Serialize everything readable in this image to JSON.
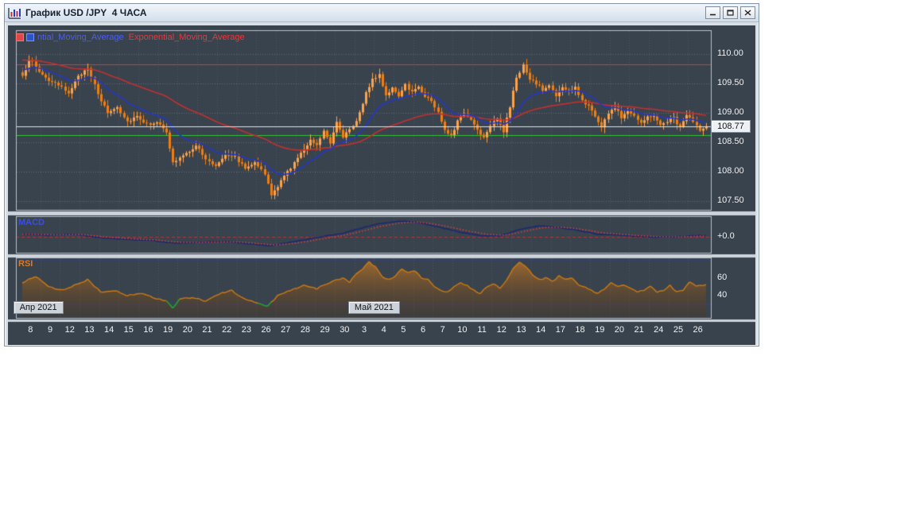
{
  "window": {
    "title": "График USD /JPY  4 ЧАСА"
  },
  "legend": {
    "ma1_label": "ntial_Moving_Average",
    "ma2_label": "Exponential_Moving_Average",
    "ma1_color": "#4b5ef0",
    "ma2_color": "#e23b3b"
  },
  "panels": {
    "macd_label": "MACD",
    "macd_color": "#3d4fd8",
    "rsi_label": "RSI",
    "rsi_color": "#e0781c"
  },
  "badges": [
    {
      "label": "Апр 2021",
      "day_index": 0.4
    },
    {
      "label": "Май 2021",
      "day_index": 17.5
    }
  ],
  "price_tag": "108.77",
  "chart_data": {
    "type": "candlestick",
    "title": "USD/JPY 4-hour candles with two exponential moving averages, MACD and RSI",
    "x_day_labels": [
      "8",
      "9",
      "12",
      "13",
      "14",
      "15",
      "16",
      "19",
      "20",
      "21",
      "22",
      "23",
      "26",
      "27",
      "28",
      "29",
      "30",
      "3",
      "4",
      "5",
      "6",
      "7",
      "10",
      "11",
      "12",
      "13",
      "14",
      "17",
      "18",
      "19",
      "20",
      "21",
      "24",
      "25",
      "26"
    ],
    "candles_per_day": 6,
    "colors": {
      "background": "#39434d",
      "panel_border": "#b9c1c9",
      "splitter": "#ccd3da",
      "grid": "rgba(255,255,255,0.22)",
      "grid_vert": "rgba(255,255,255,0.10)",
      "candle_up": "#ffa24a",
      "candle_down": "#f07d10",
      "ema_fast": "#2438c8",
      "ema_slow": "#c43030",
      "level_red": "#d83838",
      "level_green": "#28c828",
      "current_line": "#e2e2e2",
      "macd_line": "#1c2870",
      "macd_signal": "#e04040",
      "macd_zero": "#b43434",
      "rsi_line": "#cf7a12",
      "rsi_green": "#22b022",
      "rsi_level": "#2838d0",
      "axis_text": "#f0f0f0"
    },
    "main": {
      "y_range": [
        107.35,
        110.4
      ],
      "y_ticks": [
        110.0,
        109.5,
        109.0,
        108.5,
        108.0,
        107.5
      ],
      "levels": {
        "resistance_red": 109.82,
        "support_green": 108.62,
        "current_price": 108.77
      },
      "ema_fast_period": 16,
      "ema_slow_period": 56,
      "price_anchors": [
        [
          0,
          109.6
        ],
        [
          2,
          109.92
        ],
        [
          5,
          109.7
        ],
        [
          8,
          109.55
        ],
        [
          11,
          109.45
        ],
        [
          14,
          109.35
        ],
        [
          17,
          109.6
        ],
        [
          20,
          109.78
        ],
        [
          23,
          109.3
        ],
        [
          26,
          109.0
        ],
        [
          29,
          109.1
        ],
        [
          32,
          108.85
        ],
        [
          35,
          108.95
        ],
        [
          38,
          108.8
        ],
        [
          41,
          108.85
        ],
        [
          44,
          108.65
        ],
        [
          46,
          108.15
        ],
        [
          50,
          108.3
        ],
        [
          53,
          108.45
        ],
        [
          56,
          108.2
        ],
        [
          59,
          108.1
        ],
        [
          62,
          108.3
        ],
        [
          65,
          108.25
        ],
        [
          68,
          108.05
        ],
        [
          71,
          108.18
        ],
        [
          74,
          107.95
        ],
        [
          76,
          107.6
        ],
        [
          78,
          107.75
        ],
        [
          81,
          108.0
        ],
        [
          83,
          108.15
        ],
        [
          85,
          108.3
        ],
        [
          88,
          108.55
        ],
        [
          90,
          108.45
        ],
        [
          92,
          108.7
        ],
        [
          94,
          108.5
        ],
        [
          96,
          108.85
        ],
        [
          98,
          108.6
        ],
        [
          101,
          108.75
        ],
        [
          103,
          109.0
        ],
        [
          105,
          109.35
        ],
        [
          107,
          109.55
        ],
        [
          109,
          109.65
        ],
        [
          111,
          109.3
        ],
        [
          113,
          109.42
        ],
        [
          115,
          109.25
        ],
        [
          117,
          109.48
        ],
        [
          119,
          109.35
        ],
        [
          121,
          109.45
        ],
        [
          123,
          109.28
        ],
        [
          125,
          109.2
        ],
        [
          127,
          109.0
        ],
        [
          129,
          108.72
        ],
        [
          131,
          108.62
        ],
        [
          133,
          108.85
        ],
        [
          135,
          109.0
        ],
        [
          137,
          108.88
        ],
        [
          139,
          108.72
        ],
        [
          141,
          108.58
        ],
        [
          143,
          108.8
        ],
        [
          145,
          108.92
        ],
        [
          147,
          108.68
        ],
        [
          149,
          109.1
        ],
        [
          151,
          109.6
        ],
        [
          153,
          109.8
        ],
        [
          155,
          109.55
        ],
        [
          157,
          109.5
        ],
        [
          159,
          109.38
        ],
        [
          161,
          109.46
        ],
        [
          163,
          109.3
        ],
        [
          165,
          109.42
        ],
        [
          167,
          109.36
        ],
        [
          169,
          109.42
        ],
        [
          171,
          109.2
        ],
        [
          173,
          109.12
        ],
        [
          175,
          108.95
        ],
        [
          177,
          108.75
        ],
        [
          179,
          109.0
        ],
        [
          181,
          109.1
        ],
        [
          183,
          108.92
        ],
        [
          185,
          109.05
        ],
        [
          187,
          108.95
        ],
        [
          189,
          108.85
        ],
        [
          191,
          108.92
        ],
        [
          193,
          108.96
        ],
        [
          195,
          108.78
        ],
        [
          197,
          108.86
        ],
        [
          199,
          108.92
        ],
        [
          201,
          108.74
        ],
        [
          203,
          108.95
        ],
        [
          205,
          108.85
        ],
        [
          207,
          108.68
        ],
        [
          209,
          108.77
        ]
      ]
    },
    "macd": {
      "range": [
        -0.35,
        0.45
      ],
      "zero_label": "+0.0",
      "signal_period": 9,
      "anchors": [
        [
          0,
          0.06
        ],
        [
          8,
          0.03
        ],
        [
          16,
          0.05
        ],
        [
          24,
          -0.02
        ],
        [
          32,
          -0.06
        ],
        [
          40,
          -0.08
        ],
        [
          46,
          -0.14
        ],
        [
          54,
          -0.12
        ],
        [
          62,
          -0.1
        ],
        [
          70,
          -0.16
        ],
        [
          76,
          -0.2
        ],
        [
          82,
          -0.12
        ],
        [
          90,
          -0.02
        ],
        [
          98,
          0.08
        ],
        [
          104,
          0.2
        ],
        [
          110,
          0.3
        ],
        [
          116,
          0.34
        ],
        [
          122,
          0.3
        ],
        [
          128,
          0.2
        ],
        [
          134,
          0.1
        ],
        [
          140,
          0.02
        ],
        [
          146,
          0.02
        ],
        [
          152,
          0.16
        ],
        [
          158,
          0.24
        ],
        [
          164,
          0.2
        ],
        [
          170,
          0.14
        ],
        [
          176,
          0.05
        ],
        [
          182,
          0.04
        ],
        [
          188,
          0.01
        ],
        [
          194,
          -0.01
        ],
        [
          200,
          0.0
        ],
        [
          205,
          0.02
        ],
        [
          209,
          0.03
        ]
      ]
    },
    "rsi": {
      "range": [
        15,
        83
      ],
      "level_lines": [
        80,
        30
      ],
      "tick_values": [
        60,
        40
      ],
      "green_below": 31,
      "anchors": [
        [
          0,
          55
        ],
        [
          4,
          62
        ],
        [
          8,
          50
        ],
        [
          12,
          46
        ],
        [
          16,
          52
        ],
        [
          20,
          58
        ],
        [
          24,
          44
        ],
        [
          28,
          46
        ],
        [
          32,
          40
        ],
        [
          36,
          43
        ],
        [
          40,
          38
        ],
        [
          44,
          34
        ],
        [
          46,
          26
        ],
        [
          48,
          36
        ],
        [
          52,
          38
        ],
        [
          56,
          34
        ],
        [
          60,
          42
        ],
        [
          64,
          46
        ],
        [
          68,
          36
        ],
        [
          72,
          32
        ],
        [
          75,
          28
        ],
        [
          78,
          40
        ],
        [
          82,
          46
        ],
        [
          86,
          52
        ],
        [
          90,
          48
        ],
        [
          94,
          55
        ],
        [
          98,
          60
        ],
        [
          100,
          55
        ],
        [
          102,
          64
        ],
        [
          104,
          70
        ],
        [
          106,
          78
        ],
        [
          108,
          72
        ],
        [
          110,
          62
        ],
        [
          112,
          58
        ],
        [
          114,
          62
        ],
        [
          116,
          70
        ],
        [
          118,
          66
        ],
        [
          120,
          68
        ],
        [
          122,
          60
        ],
        [
          124,
          58
        ],
        [
          126,
          50
        ],
        [
          128,
          46
        ],
        [
          130,
          44
        ],
        [
          132,
          50
        ],
        [
          134,
          54
        ],
        [
          136,
          52
        ],
        [
          138,
          46
        ],
        [
          140,
          42
        ],
        [
          142,
          50
        ],
        [
          144,
          54
        ],
        [
          146,
          48
        ],
        [
          148,
          58
        ],
        [
          150,
          70
        ],
        [
          152,
          78
        ],
        [
          154,
          72
        ],
        [
          156,
          64
        ],
        [
          158,
          58
        ],
        [
          160,
          60
        ],
        [
          162,
          56
        ],
        [
          164,
          62
        ],
        [
          166,
          58
        ],
        [
          168,
          60
        ],
        [
          170,
          52
        ],
        [
          172,
          50
        ],
        [
          174,
          46
        ],
        [
          176,
          42
        ],
        [
          178,
          48
        ],
        [
          180,
          54
        ],
        [
          182,
          50
        ],
        [
          184,
          52
        ],
        [
          186,
          48
        ],
        [
          188,
          44
        ],
        [
          190,
          46
        ],
        [
          192,
          50
        ],
        [
          194,
          44
        ],
        [
          196,
          46
        ],
        [
          198,
          52
        ],
        [
          200,
          44
        ],
        [
          202,
          46
        ],
        [
          204,
          56
        ],
        [
          206,
          50
        ],
        [
          208,
          52
        ],
        [
          209,
          52
        ]
      ]
    }
  }
}
